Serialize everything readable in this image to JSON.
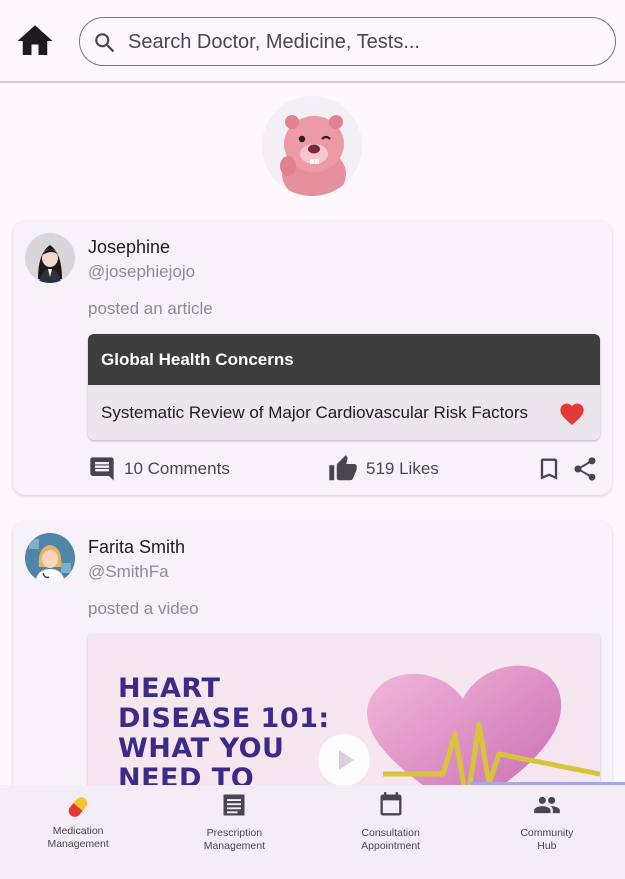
{
  "search": {
    "placeholder": "Search Doctor, Medicine, Tests..."
  },
  "posts": [
    {
      "name": "Josephine",
      "handle": "@josephiejojo",
      "action": "posted an article",
      "article_title": "Global Health Concerns",
      "article_text": "Systematic Review of Major Cardiovascular Risk Factors",
      "comments": "10 Comments",
      "likes": "519 Likes"
    },
    {
      "name": "Farita Smith",
      "handle": "@SmithFa",
      "action": "posted a video",
      "video_title": "HEART\nDISEASE 101:\nWHAT YOU\nNEED TO"
    }
  ],
  "nav": [
    {
      "label": "Medication\nManagement",
      "icon": "pill-icon"
    },
    {
      "label": "Prescription\nManagement",
      "icon": "prescription-icon"
    },
    {
      "label": "Consultation\nAppointment",
      "icon": "calendar-icon"
    },
    {
      "label": "Community\nHub",
      "icon": "people-icon"
    }
  ],
  "colors": {
    "background": "#fef7ff",
    "card": "#f7f2fa",
    "heart": "#e53935",
    "article_header": "#3d3d3d",
    "nav_bar": "#f3edf7"
  }
}
